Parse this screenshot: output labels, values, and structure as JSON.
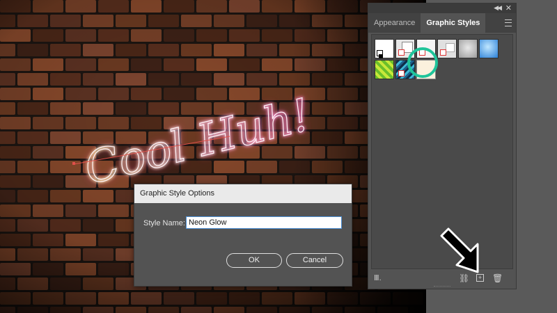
{
  "canvas": {
    "artwork_text": "Cool Huh!"
  },
  "panel": {
    "tabs": [
      {
        "label": "Appearance",
        "active": false
      },
      {
        "label": "Graphic Styles",
        "active": true
      }
    ],
    "icons": {
      "collapse": "collapse-panel-icon",
      "close": "close-panel-icon",
      "menu": "panel-menu-icon",
      "library": "graphic-styles-libraries-menu-icon",
      "break_link": "break-link-icon",
      "new_style": "new-graphic-style-icon",
      "delete": "delete-graphic-style-icon"
    },
    "swatches": [
      {
        "name": "default-style"
      },
      {
        "name": "swatch-2"
      },
      {
        "name": "swatch-3"
      },
      {
        "name": "swatch-4"
      },
      {
        "name": "swatch-5"
      },
      {
        "name": "swatch-6"
      },
      {
        "name": "swatch-7"
      },
      {
        "name": "swatch-8"
      },
      {
        "name": "neon-glow-swatch",
        "highlighted": true
      }
    ]
  },
  "dialog": {
    "title": "Graphic Style Options",
    "style_name_label": "Style Name:",
    "style_name_value": "Neon Glow",
    "ok_label": "OK",
    "cancel_label": "Cancel"
  },
  "colors": {
    "highlight": "#1fc49a",
    "input_focus": "#4c8fd6"
  }
}
